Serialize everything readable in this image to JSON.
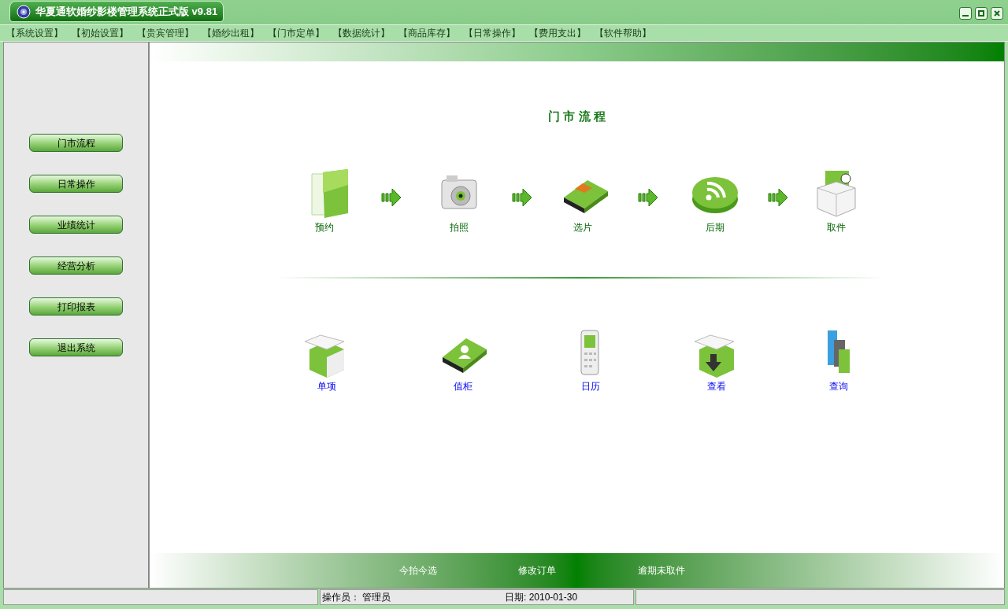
{
  "window": {
    "title": "华夏通软婚纱影楼管理系统正式版 v9.81"
  },
  "menu": [
    {
      "label": "【系统设置】"
    },
    {
      "label": "【初始设置】"
    },
    {
      "label": "【贵宾管理】"
    },
    {
      "label": "【婚纱出租】"
    },
    {
      "label": "【门市定单】"
    },
    {
      "label": "【数据统计】"
    },
    {
      "label": "【商品库存】"
    },
    {
      "label": "【日常操作】"
    },
    {
      "label": "【费用支出】"
    },
    {
      "label": "【软件帮助】"
    }
  ],
  "sidebar": {
    "buttons": [
      {
        "label": "门市流程"
      },
      {
        "label": "日常操作"
      },
      {
        "label": "业绩统计"
      },
      {
        "label": "经营分析"
      },
      {
        "label": "打印报表"
      },
      {
        "label": "退出系统"
      }
    ]
  },
  "main": {
    "title": "门 市 流 程",
    "flow_steps": [
      {
        "label": "预约",
        "kind": "folder"
      },
      {
        "label": "拍照",
        "kind": "camera"
      },
      {
        "label": "选片",
        "kind": "book"
      },
      {
        "label": "后期",
        "kind": "feed"
      },
      {
        "label": "取件",
        "kind": "package"
      }
    ],
    "shortcuts": [
      {
        "label": "单项",
        "kind": "box"
      },
      {
        "label": "值柜",
        "kind": "contacts"
      },
      {
        "label": "日历",
        "kind": "phone"
      },
      {
        "label": "查看",
        "kind": "download"
      },
      {
        "label": "查询",
        "kind": "blocks"
      }
    ]
  },
  "bottom_links": [
    {
      "label": "今拍今选"
    },
    {
      "label": "修改订单"
    },
    {
      "label": "逾期未取件"
    }
  ],
  "status_bar": {
    "operator": "操作员： 管理员",
    "date": "日期: 2010-01-30"
  }
}
